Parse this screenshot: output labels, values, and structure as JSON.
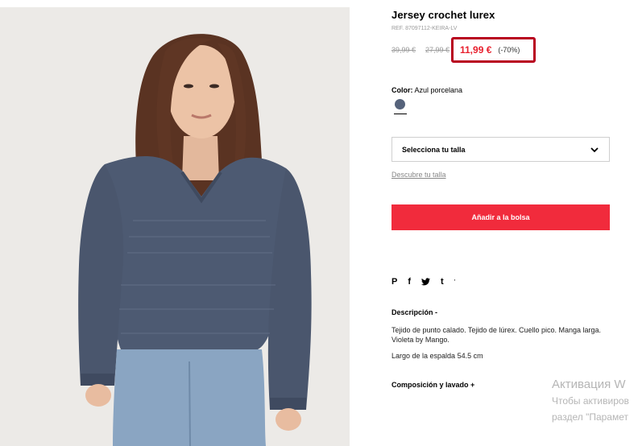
{
  "product": {
    "title": "Jersey crochet lurex",
    "ref": "REF. 87097112-KEIRA-LV",
    "old_price_1": "39,99 €",
    "old_price_2": "27,99 €",
    "price": "11,99 €",
    "discount": "(-70%)"
  },
  "color": {
    "label": "Color:",
    "value": "Azul porcelana",
    "swatch_hex": "#56637b"
  },
  "size": {
    "select_label": "Selecciona tu talla",
    "guide_link": "Descubre tu talla"
  },
  "cart": {
    "add_label": "Añadir a la bolsa",
    "button_color": "#f12b3c"
  },
  "share": {
    "icons": [
      "pinterest-icon",
      "facebook-icon",
      "twitter-icon",
      "tumblr-icon"
    ],
    "pinterest_glyph": "P",
    "facebook_glyph": "f",
    "tumblr_glyph": "t",
    "extra_glyph": "'"
  },
  "description": {
    "heading": "Descripción  -",
    "text": "Tejido de punto calado. Tejido de lúrex. Cuello pico. Manga larga. Violeta by Mango.",
    "length": "Largo de la espalda 54.5 cm"
  },
  "composition": {
    "heading": "Composición y lavado  +"
  },
  "watermark": {
    "title": "Активация W",
    "line1": "Чтобы активиров",
    "line2": "раздел \"Парамет"
  }
}
